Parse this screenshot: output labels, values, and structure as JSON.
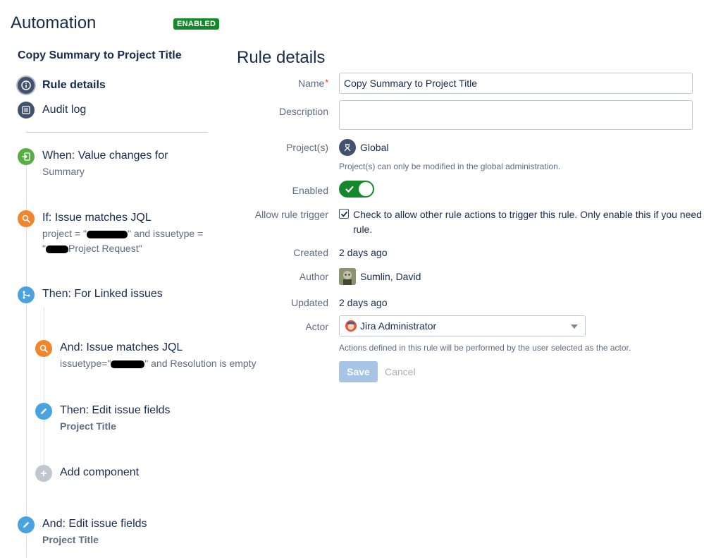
{
  "header": {
    "title": "Automation",
    "status_badge": "ENABLED"
  },
  "rule": {
    "name": "Copy Summary to Project Title"
  },
  "nav": {
    "rule_details": "Rule details",
    "audit_log": "Audit log"
  },
  "components": {
    "trigger": {
      "title": "When: Value changes for",
      "desc": "Summary"
    },
    "condition": {
      "title": "If: Issue matches JQL",
      "desc_l1_a": "project = \"",
      "desc_l1_b": "\" and issuetype =",
      "desc_l2_a": "\"",
      "desc_l2_b": "Project Request\""
    },
    "branch": {
      "title": "Then: For Linked issues"
    },
    "branch_condition": {
      "title": "And: Issue matches JQL",
      "desc_a": "issuetype=\"",
      "desc_b": "\" and Resolution is empty"
    },
    "branch_action": {
      "title": "Then: Edit issue fields",
      "desc": "Project Title"
    },
    "add_component": {
      "title": "Add component"
    },
    "final_action": {
      "title": "And: Edit issue fields",
      "desc": "Project Title"
    }
  },
  "details": {
    "title": "Rule details",
    "name_label": "Name",
    "name_value": "Copy Summary to Project Title",
    "description_label": "Description",
    "description_value": "",
    "projects_label": "Project(s)",
    "projects_value": "Global",
    "projects_help": "Project(s) can only be modified in the global administration.",
    "enabled_label": "Enabled",
    "enabled": true,
    "allow_trigger_label": "Allow rule trigger",
    "allow_trigger_checked": true,
    "allow_trigger_text": "Check to allow other rule actions to trigger this rule. Only enable this if you need rule.",
    "created_label": "Created",
    "created_value": "2 days ago",
    "author_label": "Author",
    "author_value": "Sumlin, David",
    "updated_label": "Updated",
    "updated_value": "2 days ago",
    "actor_label": "Actor",
    "actor_value": "Jira Administrator",
    "actor_help": "Actions defined in this rule will be performed by the user selected as the actor.",
    "save_label": "Save",
    "cancel_label": "Cancel"
  },
  "colors": {
    "enabled_green": "#14892c",
    "trigger_green": "#5aac44",
    "condition_orange": "#f0852b",
    "action_blue": "#4aa3df",
    "save_disabled": "#a6c4e3"
  }
}
